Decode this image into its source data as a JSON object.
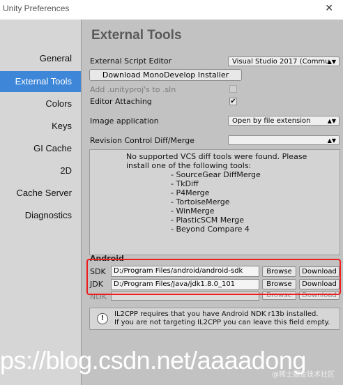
{
  "window": {
    "title": "Unity Preferences"
  },
  "sidebar": {
    "items": [
      {
        "label": "General"
      },
      {
        "label": "External Tools"
      },
      {
        "label": "Colors"
      },
      {
        "label": "Keys"
      },
      {
        "label": "GI Cache"
      },
      {
        "label": "2D"
      },
      {
        "label": "Cache Server"
      },
      {
        "label": "Diagnostics"
      }
    ],
    "active": "External Tools"
  },
  "main": {
    "heading": "External Tools",
    "script_editor_label": "External Script Editor",
    "script_editor_value": "Visual Studio 2017 (Commu",
    "download_mono_label": "Download MonoDevelop Installer",
    "add_unityproj_label": "Add .unityproj's to .sln",
    "add_unityproj_checked": false,
    "editor_attaching_label": "Editor Attaching",
    "editor_attaching_checked": true,
    "image_app_label": "Image application",
    "image_app_value": "Open by file extension",
    "revision_label": "Revision Control Diff/Merge",
    "revision_value": "",
    "vcs_message": [
      "No supported VCS diff tools were found. Please",
      "install one of the following tools:",
      "- SourceGear DiffMerge",
      "- TkDiff",
      "- P4Merge",
      "- TortoiseMerge",
      "- WinMerge",
      "- PlasticSCM Merge",
      "- Beyond Compare 4"
    ]
  },
  "android": {
    "section_label": "Android",
    "sdk": {
      "label": "SDK",
      "value": "D:/Program Files/android/android-sdk",
      "browse": "Browse",
      "download": "Download"
    },
    "jdk": {
      "label": "JDK",
      "value": "D:/Program Files/Java/jdk1.8.0_101",
      "browse": "Browse",
      "download": "Download"
    },
    "ndk": {
      "label": "NDK",
      "value": "",
      "browse": "Browse",
      "download": "Download"
    },
    "help_lines": [
      "IL2CPP requires that you have Android NDK r13b installed.",
      "If you are not targeting IL2CPP you can leave this field empty."
    ]
  },
  "watermark": {
    "url_text": "ps://blog.csdn.net/aaaadong",
    "credit": "@稀土掘金技术社区"
  }
}
